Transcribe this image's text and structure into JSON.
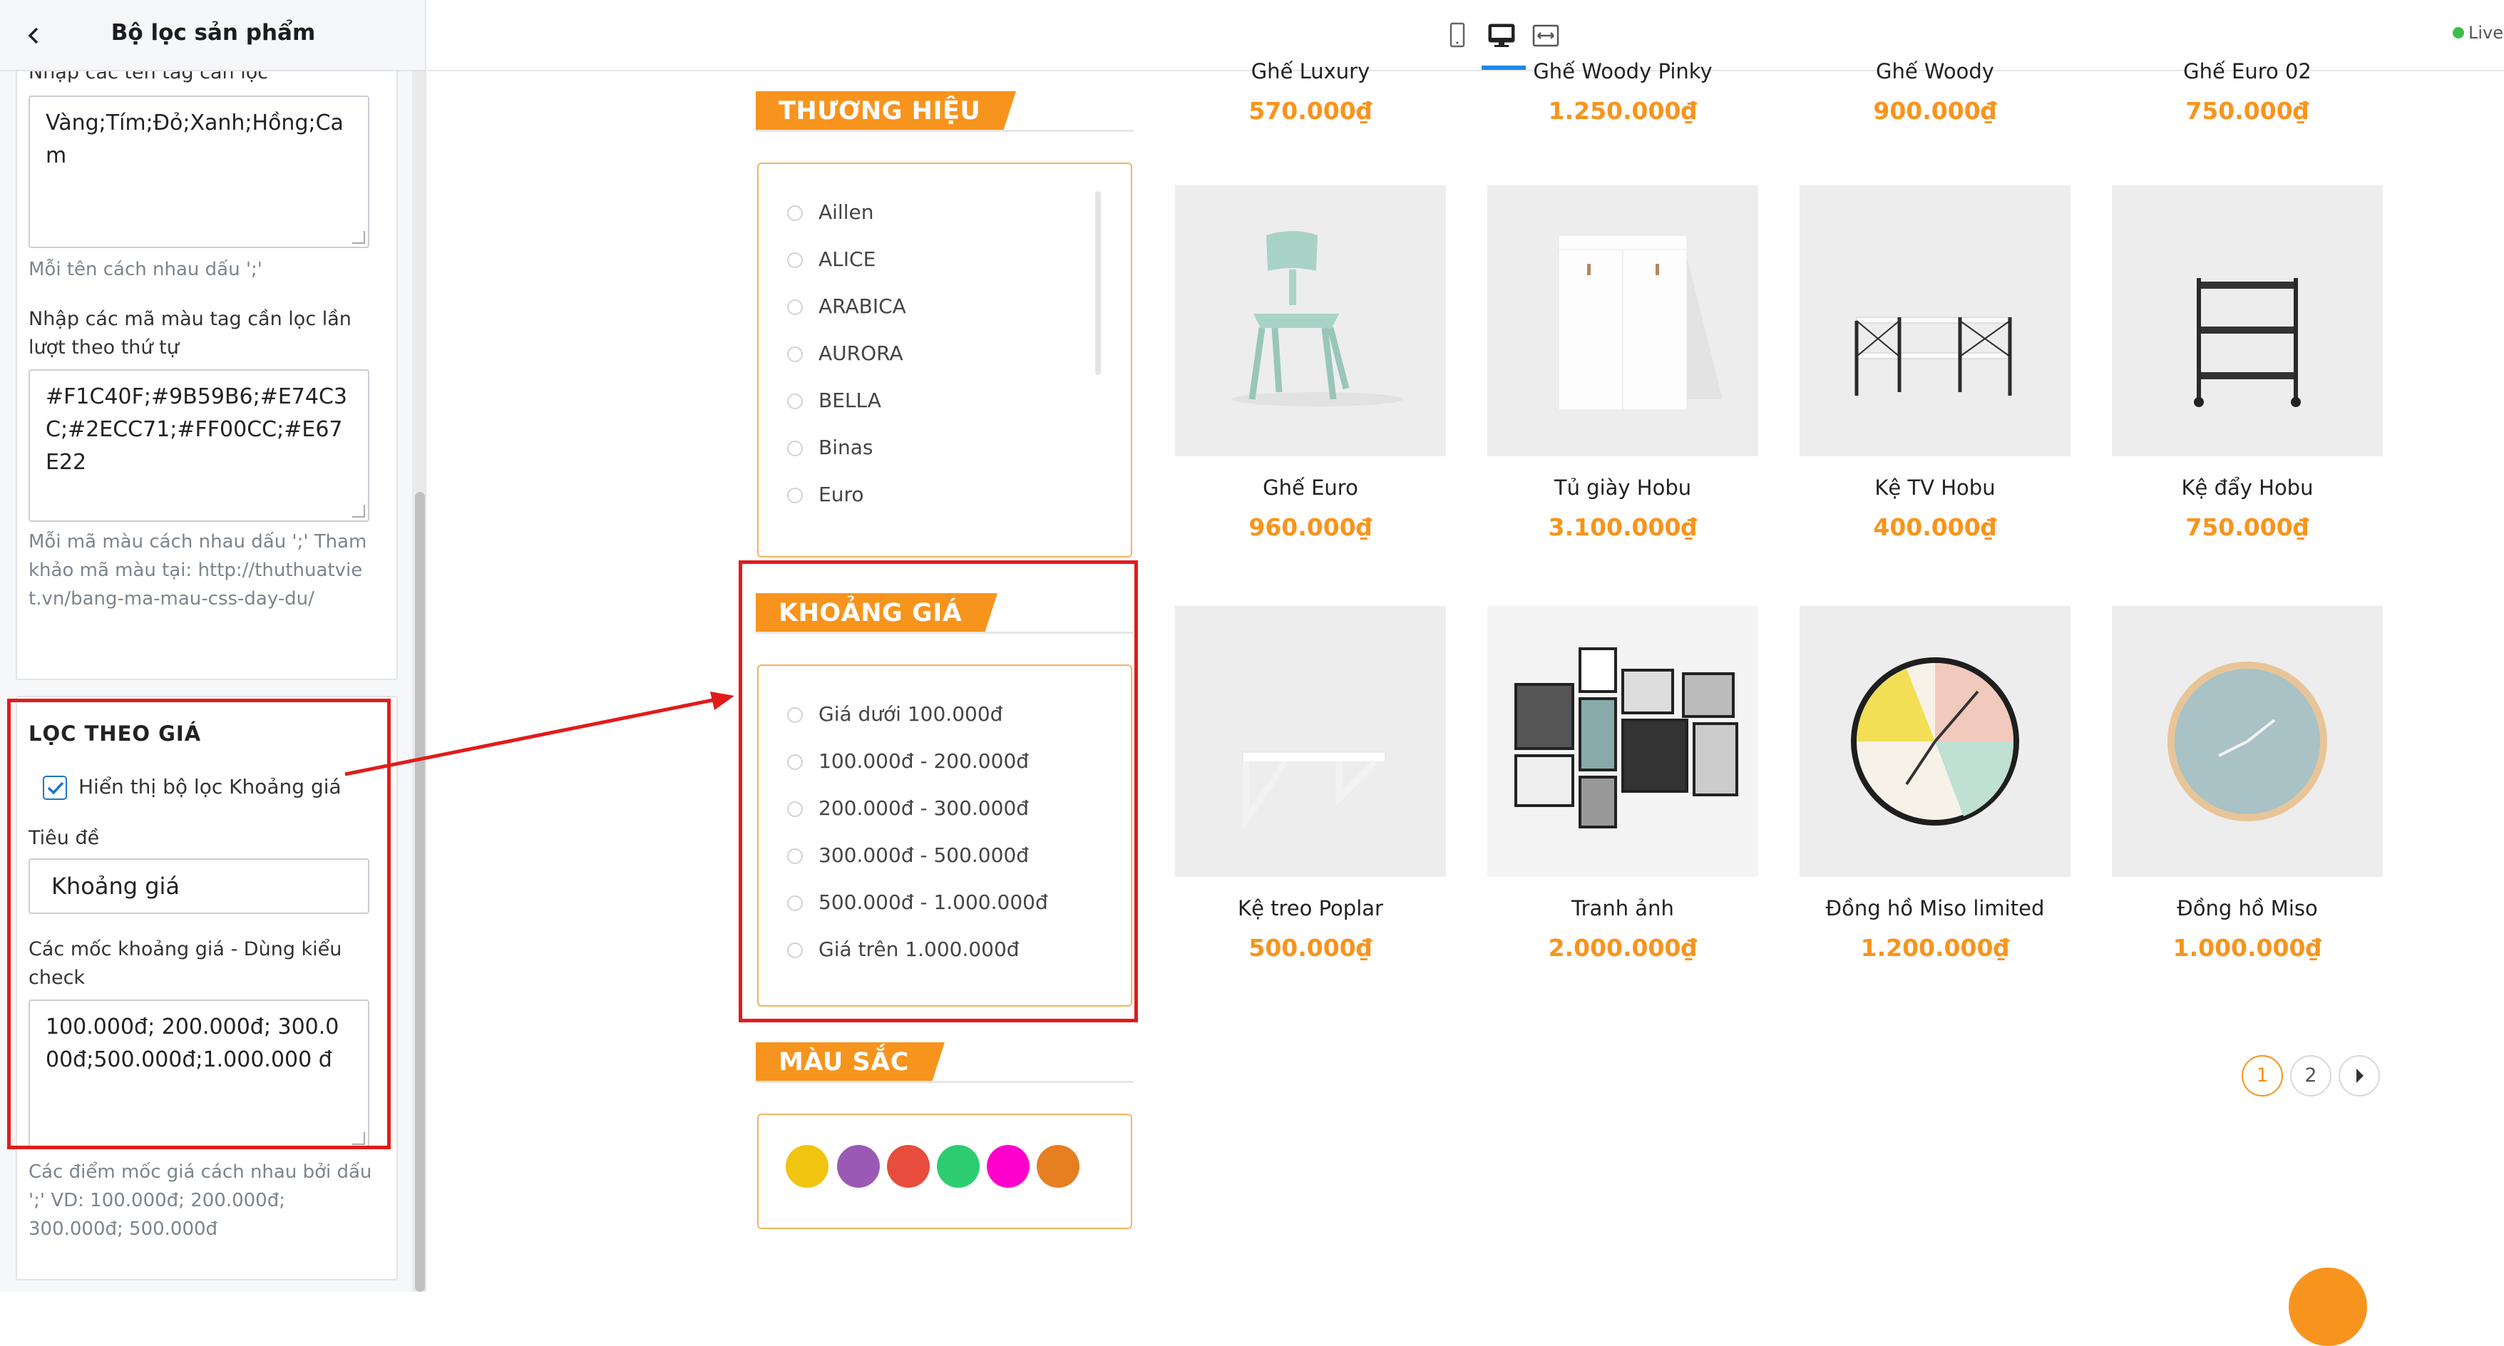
{
  "editor": {
    "title": "Bộ lọc sản phẩm",
    "tag_names_label": "Nhập các tên tag cần lọc",
    "tag_names_value": "Vàng;Tím;Đỏ;Xanh;Hồng;Cam",
    "tag_names_help": "Mỗi tên cách nhau dấu ';'",
    "tag_colors_label": "Nhập các mã màu tag cần lọc lần lượt theo thứ tự",
    "tag_colors_value": "#F1C40F;#9B59B6;#E74C3C;#2ECC71;#FF00CC;#E67E22",
    "tag_colors_help": "Mỗi mã màu cách nhau dấu ';' Tham khảo mã màu tại: http://thuthuatviet.vn/bang-ma-mau-css-day-du/",
    "price_section_heading": "LỌC THEO GIÁ",
    "price_toggle_label": "Hiển thị bộ lọc Khoảng giá",
    "price_title_label": "Tiêu đề",
    "price_title_value": "Khoảng giá",
    "price_points_label": "Các mốc khoảng giá - Dùng kiểu check",
    "price_points_value": "100.000đ; 200.000đ; 300.000đ;500.000đ;1.000.000 đ",
    "price_points_help": "Các điểm mốc giá cách nhau bởi dấu ';' VD: 100.000đ; 200.000đ; 300.000đ; 500.000đ"
  },
  "topbar": {
    "devices": [
      "mobile-icon",
      "desktop-icon",
      "fullwidth-icon"
    ],
    "active_device": "desktop",
    "live_label": "Live"
  },
  "store": {
    "brand_heading": "THƯƠNG HIỆU",
    "brands": [
      "Aillen",
      "ALICE",
      "ARABICA",
      "AURORA",
      "BELLA",
      "Binas",
      "Euro"
    ],
    "price_heading": "KHOẢNG GIÁ",
    "price_ranges": [
      "Giá dưới 100.000đ",
      "100.000đ - 200.000đ",
      "200.000đ - 300.000đ",
      "300.000đ - 500.000đ",
      "500.000đ - 1.000.000đ",
      "Giá trên 1.000.000đ"
    ],
    "color_heading": "MÀU SẮC",
    "colors": [
      "#F1C40F",
      "#9B59B6",
      "#E74C3C",
      "#2ECC71",
      "#FF00CC",
      "#E67E22"
    ],
    "previous_row": [
      {
        "name": "Ghế Luxury",
        "price": "570.000₫"
      },
      {
        "name": "Ghế Woody Pinky",
        "price": "1.250.000₫"
      },
      {
        "name": "Ghế Woody",
        "price": "900.000₫"
      },
      {
        "name": "Ghế Euro 02",
        "price": "750.000₫"
      }
    ],
    "products": [
      {
        "name": "Ghế Euro",
        "price": "960.000₫"
      },
      {
        "name": "Tủ giày Hobu",
        "price": "3.100.000₫"
      },
      {
        "name": "Kệ TV Hobu",
        "price": "400.000₫"
      },
      {
        "name": "Kệ đẩy Hobu",
        "price": "750.000₫"
      },
      {
        "name": "Kệ treo Poplar",
        "price": "500.000₫"
      },
      {
        "name": "Tranh ảnh",
        "price": "2.000.000₫"
      },
      {
        "name": "Đồng hồ Miso limited",
        "price": "1.200.000₫"
      },
      {
        "name": "Đồng hồ Miso",
        "price": "1.000.000₫"
      }
    ],
    "pagination": {
      "pages": [
        "1",
        "2"
      ],
      "current": "1"
    }
  }
}
